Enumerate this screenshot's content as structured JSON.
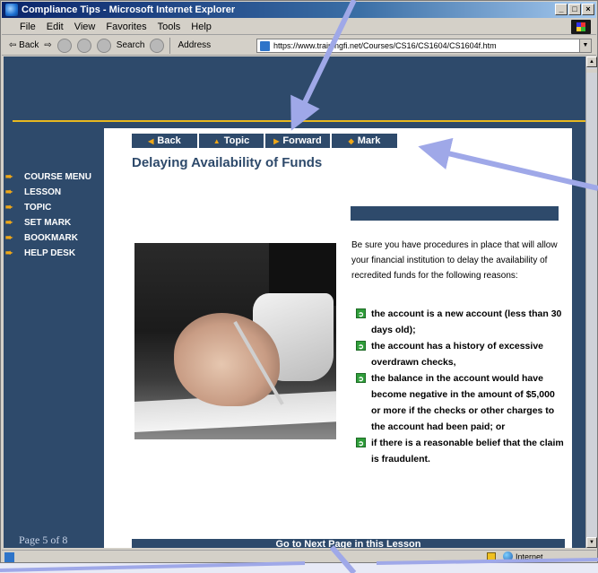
{
  "window": {
    "title": "Compliance Tips - Microsoft Internet Explorer",
    "controls": [
      "_",
      "□",
      "×"
    ]
  },
  "menubar": {
    "items": [
      "File",
      "Edit",
      "View",
      "Favorites",
      "Tools",
      "Help"
    ]
  },
  "toolbar": {
    "back": "⇦ Back",
    "forward": "⇨",
    "search": "Search",
    "address_label": "Address",
    "address_url": "https://www.trainingfi.net/Courses/CS16/CS1604/CS1604f.htm"
  },
  "sidenav": {
    "items": [
      "COURSE MENU",
      "LESSON",
      "TOPIC",
      "SET MARK",
      "BOOKMARK",
      "HELP DESK"
    ],
    "page_count": "Page 5 of 8"
  },
  "topnav": {
    "back": "Back",
    "topic": "Topic",
    "forward": "Forward",
    "mark": "Mark"
  },
  "content": {
    "heading": "Delaying Availability of Funds",
    "intro": "Be sure you have procedures in place that will allow your financial institution to delay the availability of recredited funds for the following reasons:",
    "reasons": [
      "the account is a new account (less than 30 days old);",
      "the account has a history of excessive overdrawn checks,",
      "the balance in the account would have become negative in the amount of $5,000 or more if the checks or other charges to the account had been paid; or",
      "if there is a reasonable belief that the claim is fraudulent."
    ],
    "next_link": "Go to Next Page in this Lesson"
  },
  "statusbar": {
    "zone": "Internet"
  },
  "colors": {
    "page_bg": "#2e4a6b",
    "accent_line": "#e8b820",
    "nav_arrow": "#f0a818",
    "bullet": "#2f9e3a",
    "annotation": "#9fa8e8"
  },
  "icons": {
    "nav_arrow": "➨",
    "bullet": "➲",
    "back_glyph": "◀",
    "topic_glyph": "▲",
    "forward_glyph": "▶",
    "mark_glyph": "◆"
  }
}
